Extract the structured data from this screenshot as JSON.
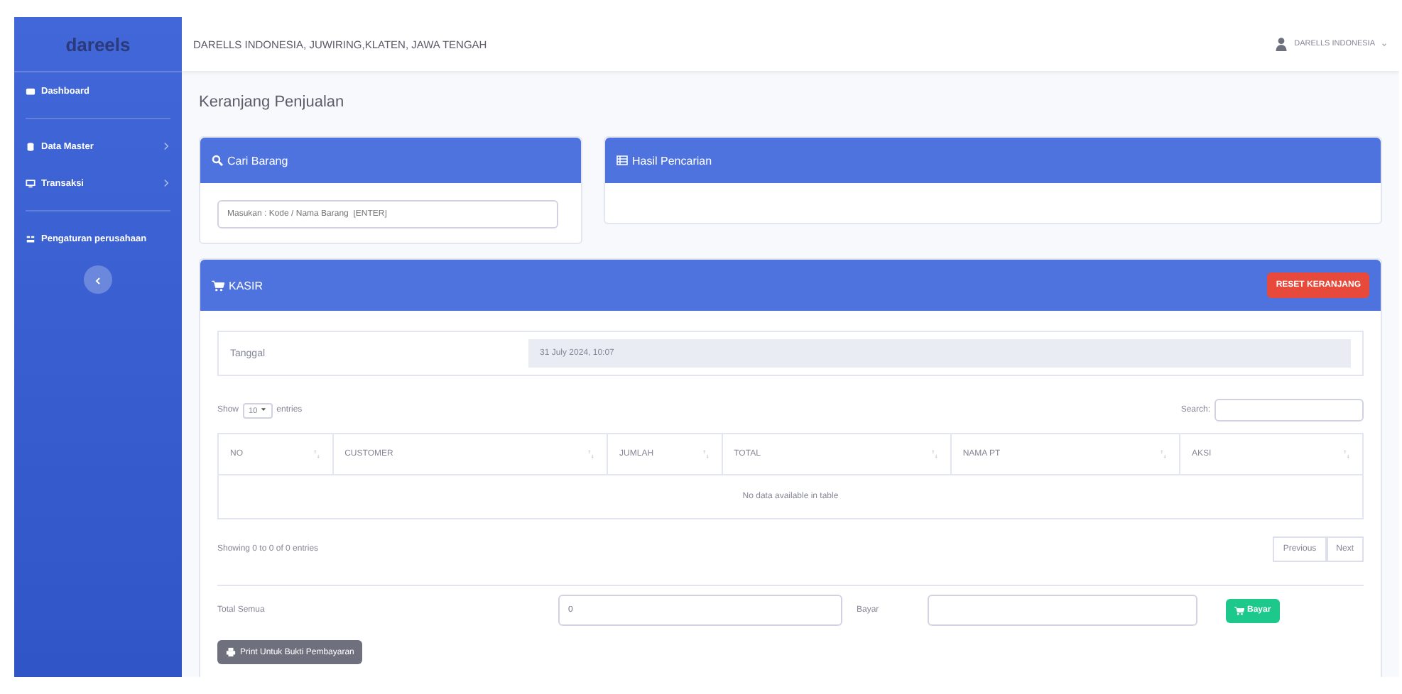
{
  "brand": "dareels",
  "sidebar": {
    "items": [
      {
        "label": "Dashboard",
        "kind": "link"
      },
      {
        "label": "Data Master",
        "kind": "menu"
      },
      {
        "label": "Transaksi",
        "kind": "menu"
      },
      {
        "label": "Pengaturan perusahaan",
        "kind": "link"
      }
    ]
  },
  "topbar": {
    "title": "DARELLS INDONESIA, JUWIRING,KLATEN, JAWA TENGAH",
    "user": "DARELLS INDONESIA"
  },
  "page_title": "Keranjang Penjualan",
  "search_card": {
    "title": "Cari Barang",
    "placeholder": "Masukan : Kode / Nama Barang  [ENTER]"
  },
  "result_card": {
    "title": "Hasil Pencarian"
  },
  "kasir": {
    "title": "KASIR",
    "reset_button": "RESET KERANJANG",
    "date_label": "Tanggal",
    "date_value": "31 July 2024, 10:07",
    "show_label": "Show",
    "page_size": "10",
    "entries_label": "entries",
    "search_label": "Search:",
    "columns": [
      "NO",
      "CUSTOMER",
      "JUMLAH",
      "TOTAL",
      "NAMA PT",
      "AKSI"
    ],
    "empty": "No data available in table",
    "info": "Showing 0 to 0 of 0 entries",
    "pagination": [
      "Previous",
      "Next"
    ],
    "total_label": "Total Semua",
    "total_value": "0",
    "pay_label": "Bayar",
    "pay_button": "Bayar",
    "print_button": "Print Untuk Bukti Pembayaran"
  }
}
